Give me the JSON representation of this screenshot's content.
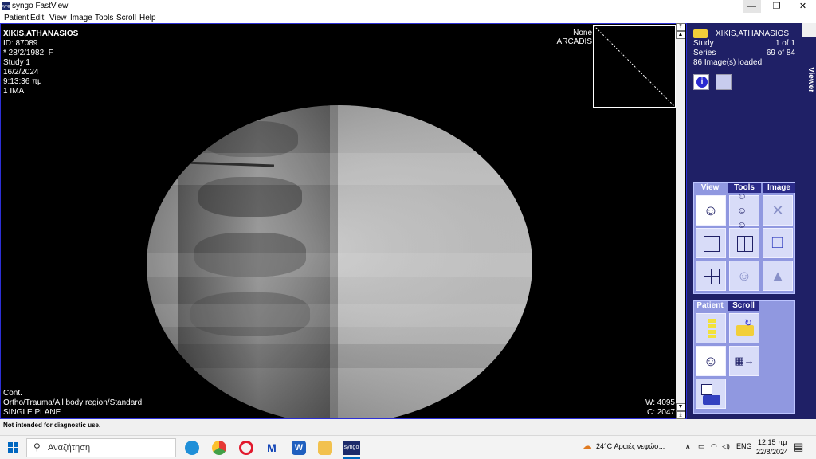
{
  "window": {
    "title": "syngo FastView",
    "icon_label": "syngo",
    "controls": {
      "minimize": "—",
      "maximize": "❐",
      "close": "✕"
    }
  },
  "menu": [
    "Patient",
    "Edit",
    "View",
    "Image",
    "Tools",
    "Scroll",
    "Help"
  ],
  "overlay": {
    "top_left": [
      "XIKIS,ATHANASIOS",
      "ID: 87089",
      "* 28/2/1982, F",
      "Study 1",
      "16/2/2024",
      "9:13:36 πμ",
      "1 IMA"
    ],
    "top_right": [
      "None",
      "ARCADIS"
    ],
    "bottom_left": [
      "Cont.",
      "Ortho/Trauma/All body region/Standard",
      "SINGLE PLANE"
    ],
    "bottom_right": [
      "W: 4095",
      "C: 2047"
    ]
  },
  "panel": {
    "patient_name": "XIKIS,ATHANASIOS",
    "study_label": "Study",
    "study_value": "1 of 1",
    "series_label": "Series",
    "series_value": "69 of 84",
    "images_loaded": "86 Image(s) loaded",
    "side_tab": "Viewer",
    "view_tabs": [
      "View",
      "Tools",
      "Image"
    ],
    "patient_tabs": [
      "Patient",
      "Scroll"
    ]
  },
  "status_line": "Not intended for diagnostic use.",
  "taskbar": {
    "search_placeholder": "Αναζήτηση",
    "weather": "24°C  Αραιές νεφώσ...",
    "lang": "ENG",
    "time": "12:15 πμ",
    "date": "22/8/2024",
    "syngo_label": "syngo"
  },
  "colors": {
    "panel_bg": "#1f2066",
    "tab_group_bg": "#9098e0",
    "viewer_border": "#2d2fd6"
  }
}
